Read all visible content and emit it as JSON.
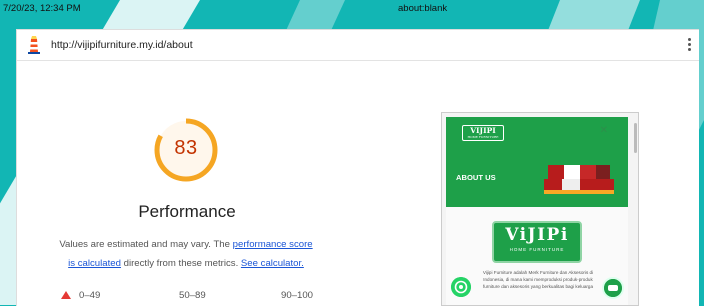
{
  "print_header": {
    "date": "7/20/23, 12:34 PM",
    "title": "about:blank"
  },
  "url_bar": {
    "url": "http://vijipifurniture.my.id/about"
  },
  "performance": {
    "score": "83",
    "score_fraction": 0.83,
    "title": "Performance",
    "desc_text1": "Values are estimated and may vary. The ",
    "link_score": "performance score",
    "link_calc": "is calculated",
    "desc_text2": " directly from these metrics. ",
    "link_calculator": "See calculator."
  },
  "legend": {
    "fail": "0–49",
    "average": "50–89",
    "pass": "90–100"
  },
  "screenshot": {
    "logo_text": "VIJIPI",
    "logo_sub": "HOME FURNITURE",
    "about_label": "ABOUT US",
    "big_logo_text": "ViJIPi",
    "big_logo_sub": "HOME FURNITURE",
    "body_text": "Vijipi Furniture adalah Merk Furniture dan Aksesoris di Indonesia, di mana kami memproduksi produk-produk furniture dan aksesoris yang berkualitas bagi keluarga"
  },
  "colors": {
    "background": "#12b6b4",
    "gauge_average": "#f5a623",
    "score_text": "#c33300",
    "fail": "#e53935",
    "link": "#1a55d6",
    "brand_green": "#1ea049"
  }
}
